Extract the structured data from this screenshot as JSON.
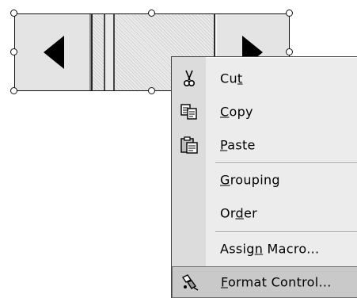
{
  "scrollbar_control": {
    "thumb_position": 0.1
  },
  "context_menu": {
    "items": [
      {
        "pre": "Cu",
        "key": "t",
        "post": "",
        "icon": "scissors-icon",
        "submenu": false,
        "selected": false
      },
      {
        "pre": "",
        "key": "C",
        "post": "opy",
        "icon": "copy-icon",
        "submenu": false,
        "selected": false
      },
      {
        "pre": "",
        "key": "P",
        "post": "aste",
        "icon": "paste-icon",
        "submenu": false,
        "selected": false
      },
      {
        "pre": "",
        "key": "G",
        "post": "rouping",
        "icon": "",
        "submenu": true,
        "selected": false
      },
      {
        "pre": "Or",
        "key": "d",
        "post": "er",
        "icon": "",
        "submenu": true,
        "selected": false
      },
      {
        "pre": "Assig",
        "key": "n",
        "post": " Macro...",
        "icon": "",
        "submenu": false,
        "selected": false
      },
      {
        "pre": "",
        "key": "F",
        "post": "ormat Control...",
        "icon": "format-control-icon",
        "submenu": false,
        "selected": true
      }
    ]
  }
}
